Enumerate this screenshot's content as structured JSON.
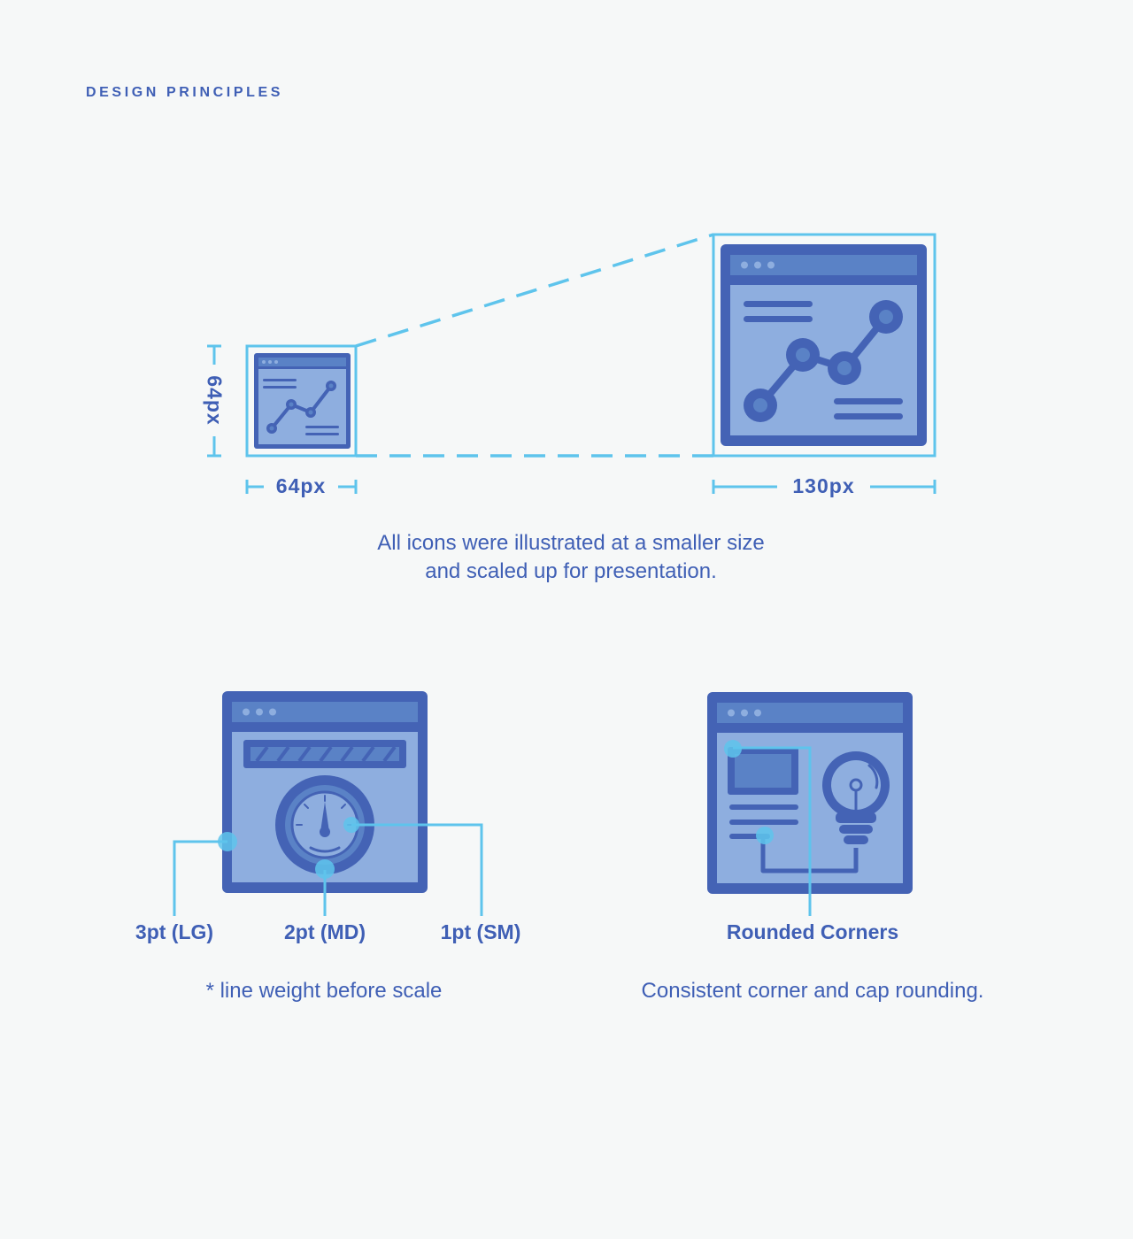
{
  "heading": "DESIGN PRINCIPLES",
  "scale_section": {
    "small_width_label": "64px",
    "small_height_label": "64px",
    "large_width_label": "130px",
    "caption_line1": "All icons were illustrated at a smaller size",
    "caption_line2": "and scaled up for presentation."
  },
  "line_weight_section": {
    "labels": [
      "3pt (LG)",
      "2pt (MD)",
      "1pt (SM)"
    ],
    "footnote": "* line weight before scale"
  },
  "corners_section": {
    "label": "Rounded Corners",
    "caption": "Consistent corner and cap rounding."
  },
  "colors": {
    "frame_dark": "#4463b5",
    "frame_light": "#8eaedf",
    "titlebar": "#5a82c6",
    "accent_cyan": "#5ec4ec",
    "text_blue": "#3f5fb5",
    "background": "#f6f8f8"
  },
  "icons": [
    "chart-window-icon",
    "gauge-window-icon",
    "lightbulb-window-icon"
  ]
}
